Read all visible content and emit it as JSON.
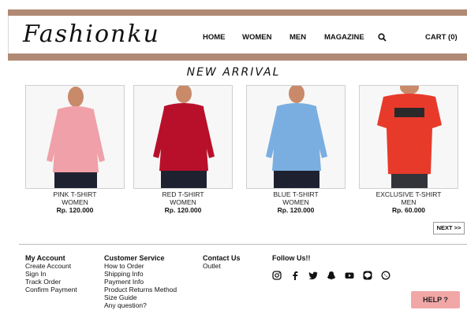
{
  "header": {
    "logo": "Fashionku",
    "nav": {
      "home": "HOME",
      "women": "WOMEN",
      "men": "MEN",
      "magazine": "MAGAZINE",
      "cart": "CART (0)"
    }
  },
  "main": {
    "section_title": "NEW ARRIVAL",
    "products": [
      {
        "name": "PINK T-SHIRT",
        "category": "WOMEN",
        "price": "Rp. 120.000",
        "color": "#f0a0a8"
      },
      {
        "name": "RED T-SHIRT",
        "category": "WOMEN",
        "price": "Rp. 120.000",
        "color": "#b8102a"
      },
      {
        "name": "BLUE T-SHIRT",
        "category": "WOMEN",
        "price": "Rp. 120.000",
        "color": "#7aaee0"
      },
      {
        "name": "EXCLUSIVE T-SHIRT",
        "category": "MEN",
        "price": "Rp. 60.000",
        "color": "#e83a2a"
      }
    ],
    "next_label": "NEXT >>"
  },
  "footer": {
    "account": {
      "title": "My Account",
      "links": [
        "Create Account",
        "Sign In",
        "Track Order",
        "Confirm Payment"
      ]
    },
    "service": {
      "title": "Customer Service",
      "links": [
        "How to Order",
        "Shipping Info",
        "Payment Info",
        "Product Returns Method",
        "Size Guide",
        "Any question?"
      ]
    },
    "contact": {
      "title": "Contact Us",
      "links": [
        "Outlet"
      ]
    },
    "follow": {
      "title": "Follow Us!!",
      "icons": [
        "instagram-icon",
        "facebook-icon",
        "twitter-icon",
        "snapchat-icon",
        "youtube-icon",
        "line-icon",
        "whatsapp-icon"
      ]
    }
  },
  "help": {
    "label": "HELP ?"
  },
  "colors": {
    "brand_bar": "#b08a74",
    "help_bg": "#f2a7a7"
  }
}
